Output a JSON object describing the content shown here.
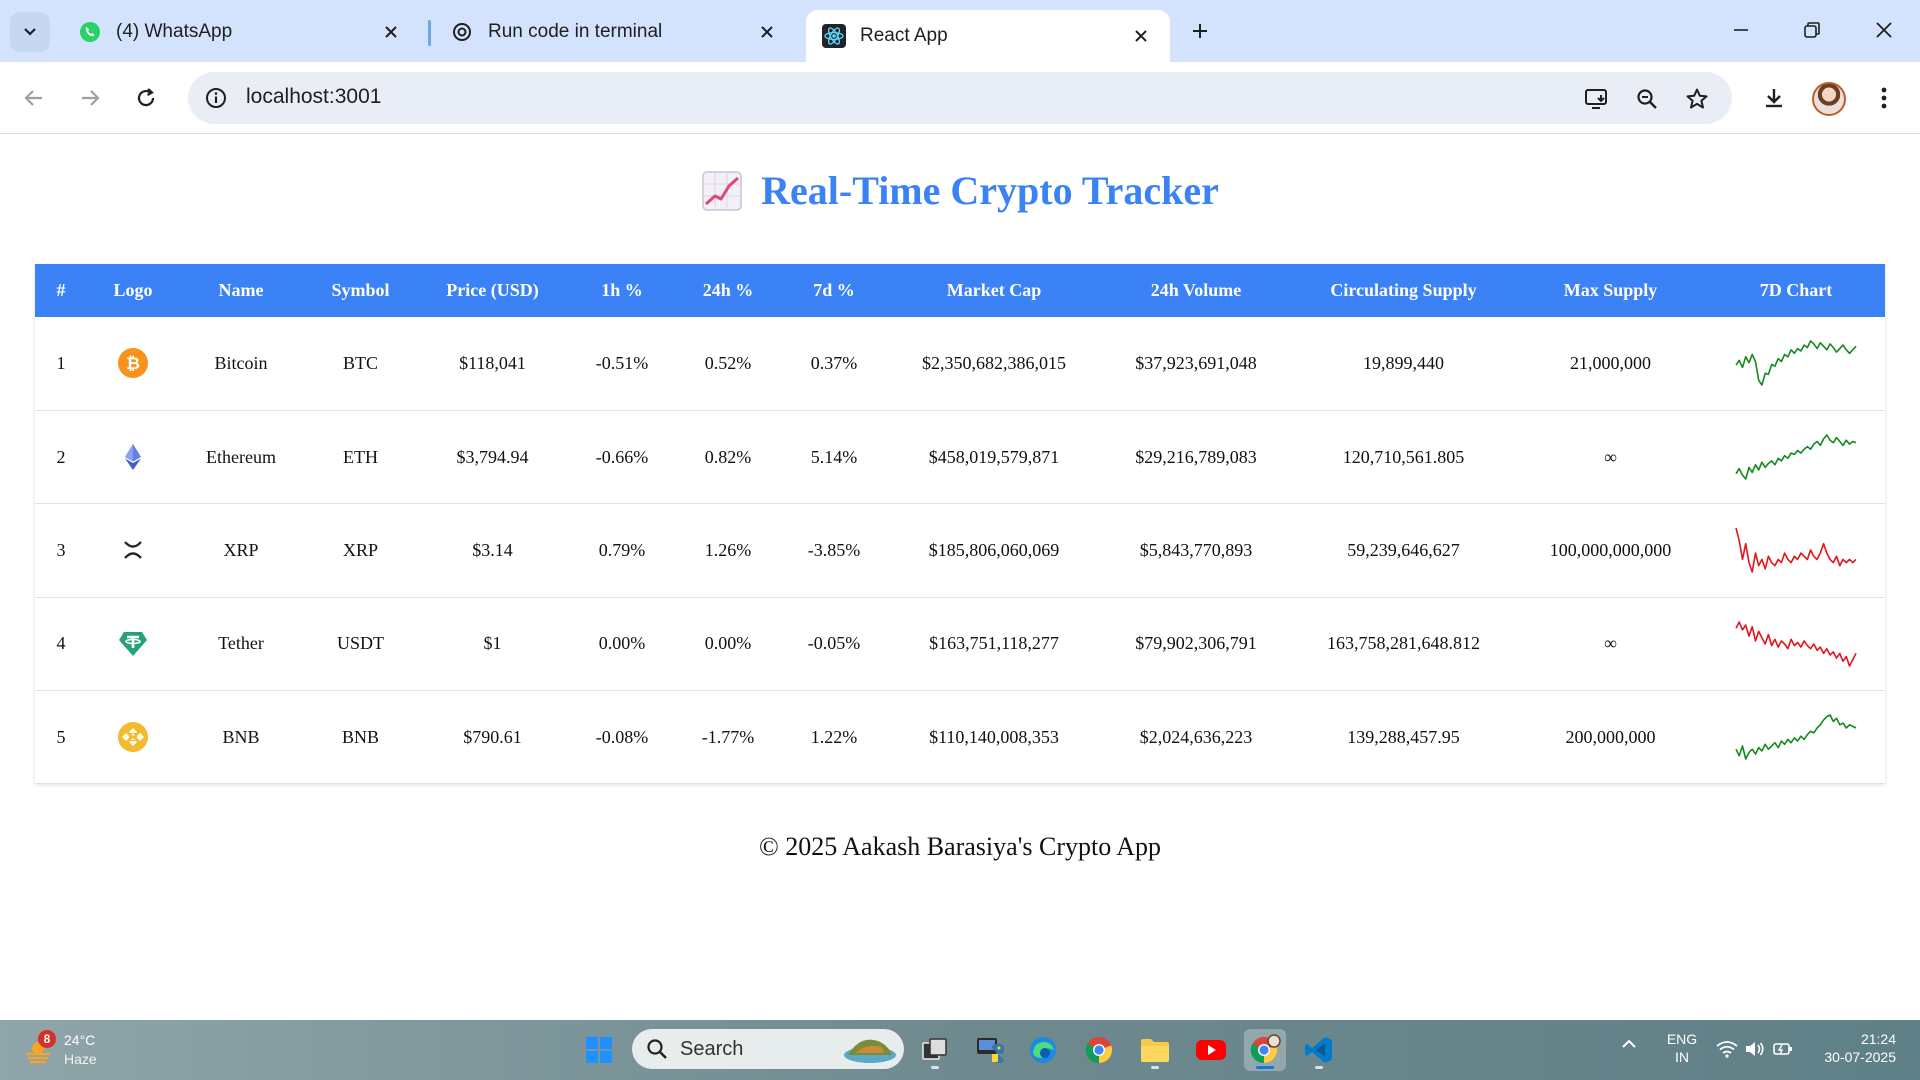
{
  "browser": {
    "tabs": [
      {
        "title": "(4) WhatsApp",
        "icon": "whatsapp-icon",
        "active": false
      },
      {
        "title": "Run code in terminal",
        "icon": "chatgpt-icon",
        "active": false
      },
      {
        "title": "React App",
        "icon": "react-icon",
        "active": true
      }
    ],
    "url": "localhost:3001"
  },
  "app": {
    "title": "Real-Time Crypto Tracker",
    "title_icon": "chart-increasing-icon",
    "footer": "© 2025 Aakash Barasiya's Crypto App",
    "accent_color": "#3b82f6",
    "positive_color": "#16891d",
    "negative_color": "#e4141b"
  },
  "table": {
    "headers": [
      "#",
      "Logo",
      "Name",
      "Symbol",
      "Price (USD)",
      "1h %",
      "24h %",
      "7d %",
      "Market Cap",
      "24h Volume",
      "Circulating Supply",
      "Max Supply",
      "7D Chart"
    ],
    "rows": [
      {
        "rank": "1",
        "logo": "bitcoin-logo",
        "name": "Bitcoin",
        "symbol": "BTC",
        "price": "$118,041",
        "h1": "-0.51%",
        "h24": "0.52%",
        "d7": "0.37%",
        "market_cap": "$2,350,682,386,015",
        "volume": "$37,923,691,048",
        "circulating": "19,899,440",
        "max_supply": "21,000,000",
        "trend": "up",
        "spark": [
          44,
          52,
          40,
          58,
          48,
          62,
          50,
          18,
          10,
          30,
          28,
          45,
          42,
          55,
          50,
          62,
          58,
          70,
          64,
          72,
          68,
          78,
          74,
          85,
          80,
          72,
          82,
          76,
          70,
          80,
          74,
          66,
          72,
          78,
          70,
          64,
          70,
          76
        ]
      },
      {
        "rank": "2",
        "logo": "ethereum-logo",
        "name": "Ethereum",
        "symbol": "ETH",
        "price": "$3,794.94",
        "h1": "-0.66%",
        "h24": "0.82%",
        "d7": "5.14%",
        "market_cap": "$458,019,579,871",
        "volume": "$29,216,789,083",
        "circulating": "120,710,561.805",
        "max_supply": "∞",
        "trend": "up",
        "spark": [
          20,
          28,
          18,
          12,
          30,
          22,
          34,
          26,
          38,
          30,
          36,
          40,
          34,
          44,
          40,
          48,
          44,
          52,
          50,
          56,
          52,
          58,
          62,
          58,
          66,
          70,
          64,
          74,
          80,
          72,
          68,
          76,
          70,
          64,
          72,
          66,
          70,
          68
        ]
      },
      {
        "rank": "3",
        "logo": "xrp-logo",
        "name": "XRP",
        "symbol": "XRP",
        "price": "$3.14",
        "h1": "0.79%",
        "h24": "1.26%",
        "d7": "-3.85%",
        "market_cap": "$185,806,060,069",
        "volume": "$5,843,770,893",
        "circulating": "59,239,646,627",
        "max_supply": "100,000,000,000",
        "trend": "down",
        "spark": [
          80,
          72,
          60,
          70,
          58,
          52,
          64,
          56,
          60,
          54,
          62,
          58,
          56,
          60,
          58,
          64,
          60,
          58,
          62,
          60,
          64,
          62,
          60,
          66,
          62,
          60,
          64,
          70,
          64,
          60,
          58,
          62,
          56,
          60,
          58,
          60,
          58,
          60
        ]
      },
      {
        "rank": "4",
        "logo": "tether-logo",
        "name": "Tether",
        "symbol": "USDT",
        "price": "$1",
        "h1": "0.00%",
        "h24": "0.00%",
        "d7": "-0.05%",
        "market_cap": "$163,751,118,277",
        "volume": "$79,902,306,791",
        "circulating": "163,758,281,648.812",
        "max_supply": "∞",
        "trend": "down",
        "spark": [
          72,
          80,
          70,
          76,
          62,
          74,
          56,
          68,
          60,
          52,
          64,
          50,
          58,
          48,
          56,
          52,
          46,
          58,
          50,
          54,
          48,
          56,
          50,
          46,
          52,
          44,
          48,
          40,
          46,
          38,
          42,
          34,
          40,
          30,
          36,
          24,
          32,
          40
        ]
      },
      {
        "rank": "5",
        "logo": "bnb-logo",
        "name": "BNB",
        "symbol": "BNB",
        "price": "$790.61",
        "h1": "-0.08%",
        "h24": "-1.77%",
        "d7": "1.22%",
        "market_cap": "$110,140,008,353",
        "volume": "$2,024,636,223",
        "circulating": "139,288,457.95",
        "max_supply": "200,000,000",
        "trend": "up",
        "spark": [
          30,
          22,
          34,
          18,
          26,
          30,
          24,
          32,
          28,
          36,
          30,
          34,
          38,
          32,
          40,
          36,
          42,
          38,
          44,
          40,
          46,
          42,
          48,
          52,
          50,
          56,
          60,
          66,
          70,
          72,
          64,
          68,
          60,
          62,
          56,
          60,
          58,
          56
        ]
      }
    ]
  },
  "taskbar": {
    "weather_temp": "24°C",
    "weather_desc": "Haze",
    "weather_badge": "8",
    "search_label": "Search",
    "lang_top": "ENG",
    "lang_bottom": "IN",
    "time": "21:24",
    "date": "30-07-2025"
  }
}
